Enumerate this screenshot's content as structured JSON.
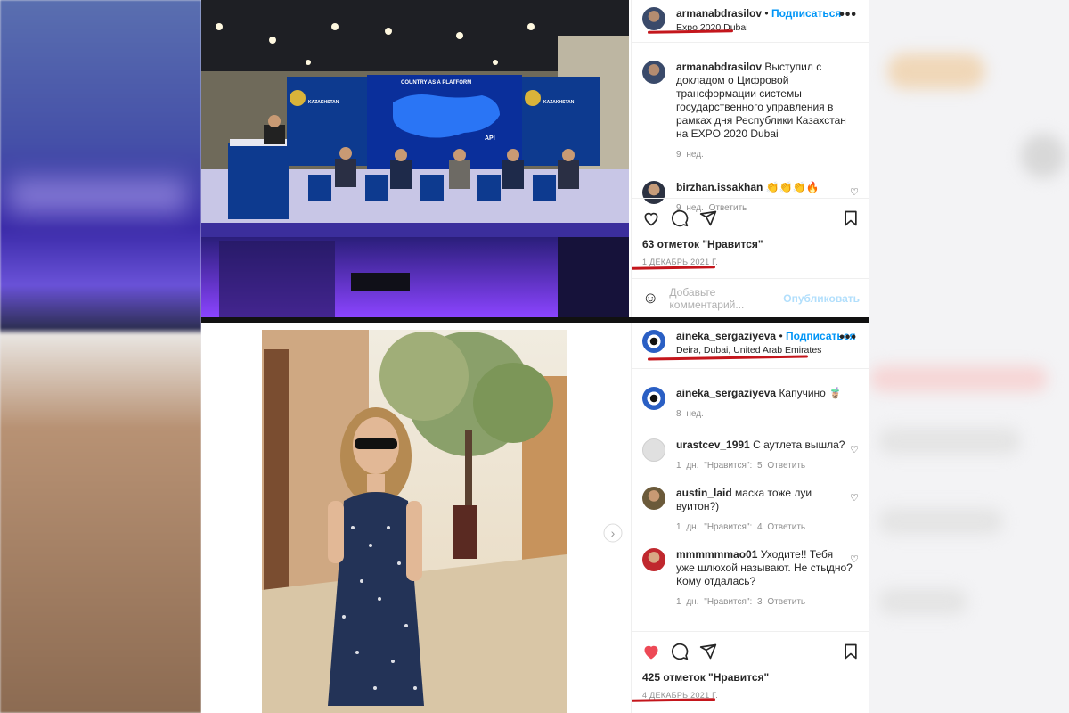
{
  "post1": {
    "username": "armanabdrasilov",
    "follow": "Подписаться",
    "location": "Expo 2020 Dubai",
    "slide_title": "COUNTRY AS A PLATFORM",
    "slide_api": "API",
    "banner_text": "KAZAKHSTAN",
    "caption": {
      "username": "armanabdrasilov",
      "text": "Выступил с докладом о Цифровой трансформации системы государственного управления в рамках дня Республики Казахстан на EXPO 2020 Dubai",
      "time": "9 нед."
    },
    "comments": [
      {
        "username": "birzhan.issakhan",
        "text": "👏👏👏🔥",
        "time": "9 нед.",
        "reply": "Ответить"
      }
    ],
    "likes": "63 отметок \"Нравится\"",
    "date": "1 ДЕКАБРЬ 2021 Г.",
    "add_comment_placeholder": "Добавьте комментарий...",
    "publish": "Опубликовать"
  },
  "post2": {
    "username": "aineka_sergaziyeva",
    "follow": "Подписаться",
    "location": "Deira, Dubai, United Arab Emirates",
    "caption": {
      "username": "aineka_sergaziyeva",
      "text": "Капучино 🧋",
      "time": "8 нед."
    },
    "comments": [
      {
        "username": "urastcev_1991",
        "text": "С аутлета вышла?",
        "time": "1 дн.",
        "likes": "\"Нравится\": 5",
        "reply": "Ответить"
      },
      {
        "username": "austin_laid",
        "text": "маска тоже луи вуитон?)",
        "time": "1 дн.",
        "likes": "\"Нравится\": 4",
        "reply": "Ответить"
      },
      {
        "username": "mmmmmmao01",
        "text": "Уходите!! Тебя уже шлюхой называют. Не стыдно? Кому отдалась?",
        "time": "1 дн.",
        "likes": "\"Нравится\": 3",
        "reply": "Ответить"
      }
    ],
    "likes": "425 отметок \"Нравится\"",
    "date": "4 ДЕКАБРЬ 2021 Г."
  },
  "colors": {
    "accent": "#0095f6",
    "red_mark": "#c4161c",
    "like_red": "#ed4956"
  }
}
